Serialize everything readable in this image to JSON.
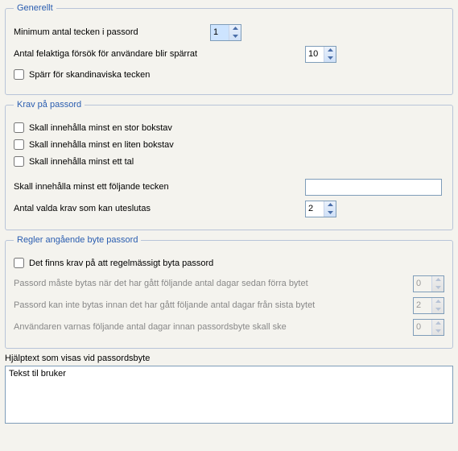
{
  "general": {
    "legend": "Generellt",
    "min_chars_label": "Minimum antal tecken i passord",
    "min_chars_value": "1",
    "fail_attempts_label": "Antal felaktiga försök för användare blir spärrat",
    "fail_attempts_value": "10",
    "scandi_block_label": "Spärr för skandinaviska tecken"
  },
  "requirements": {
    "legend": "Krav på passord",
    "upper_label": "Skall innehålla minst en stor bokstav",
    "lower_label": "Skall innehålla minst en liten bokstav",
    "digit_label": "Skall innehålla minst ett tal",
    "special_label": "Skall innehålla minst ett  följande tecken",
    "special_value": "",
    "exclude_label": "Antal valda krav som kan uteslutas",
    "exclude_value": "2"
  },
  "change_rules": {
    "legend": "Regler angående byte  passord",
    "require_change_label": "Det finns krav på att regelmässigt byta passord",
    "max_days_label": "Passord måste bytas när det har gått följande antal dagar sedan förra bytet",
    "max_days_value": "0",
    "min_days_label": "Passord kan inte bytas innan det har gått följande antal dagar från sista bytet",
    "min_days_value": "2",
    "warn_days_label": "Användaren varnas följande antal dagar innan passordsbyte skall ske",
    "warn_days_value": "0"
  },
  "help": {
    "label": "Hjälptext som visas vid passordsbyte",
    "text": "Tekst til bruker"
  }
}
